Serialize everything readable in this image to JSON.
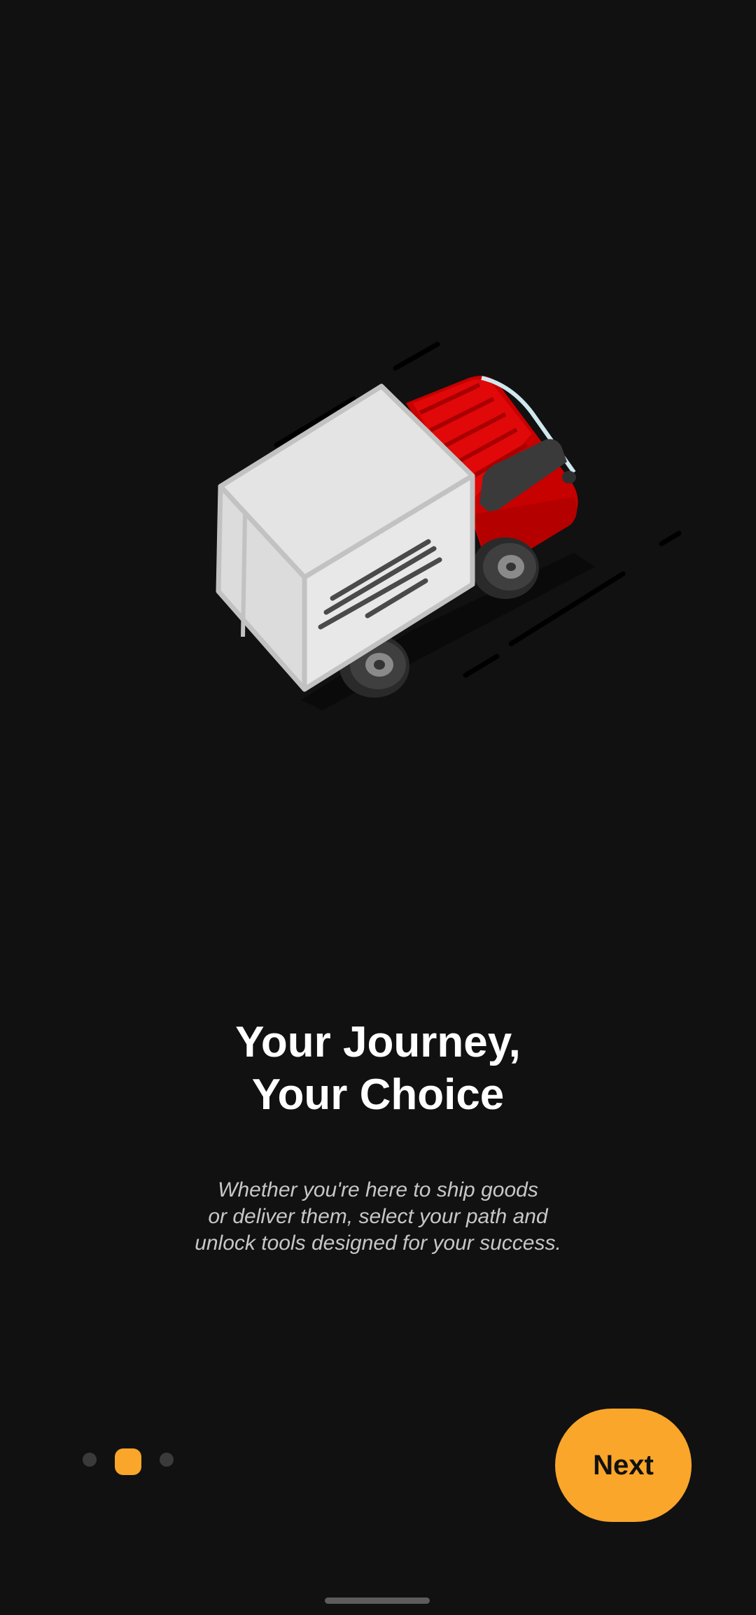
{
  "onboarding": {
    "title_line1": "Your Journey,",
    "title_line2": "Your Choice",
    "description_line1": "Whether you're here to ship goods",
    "description_line2": "or deliver them, select your path and",
    "description_line3": "unlock tools designed for your success."
  },
  "pager": {
    "total_pages": 3,
    "current_page": 2
  },
  "actions": {
    "next_label": "Next"
  },
  "illustration": {
    "icon": "delivery-truck-icon"
  },
  "colors": {
    "background": "#111111",
    "accent": "#f9a62a",
    "truck_cab": "#d40000",
    "text_primary": "#ffffff",
    "text_secondary": "#c7c7c7"
  }
}
